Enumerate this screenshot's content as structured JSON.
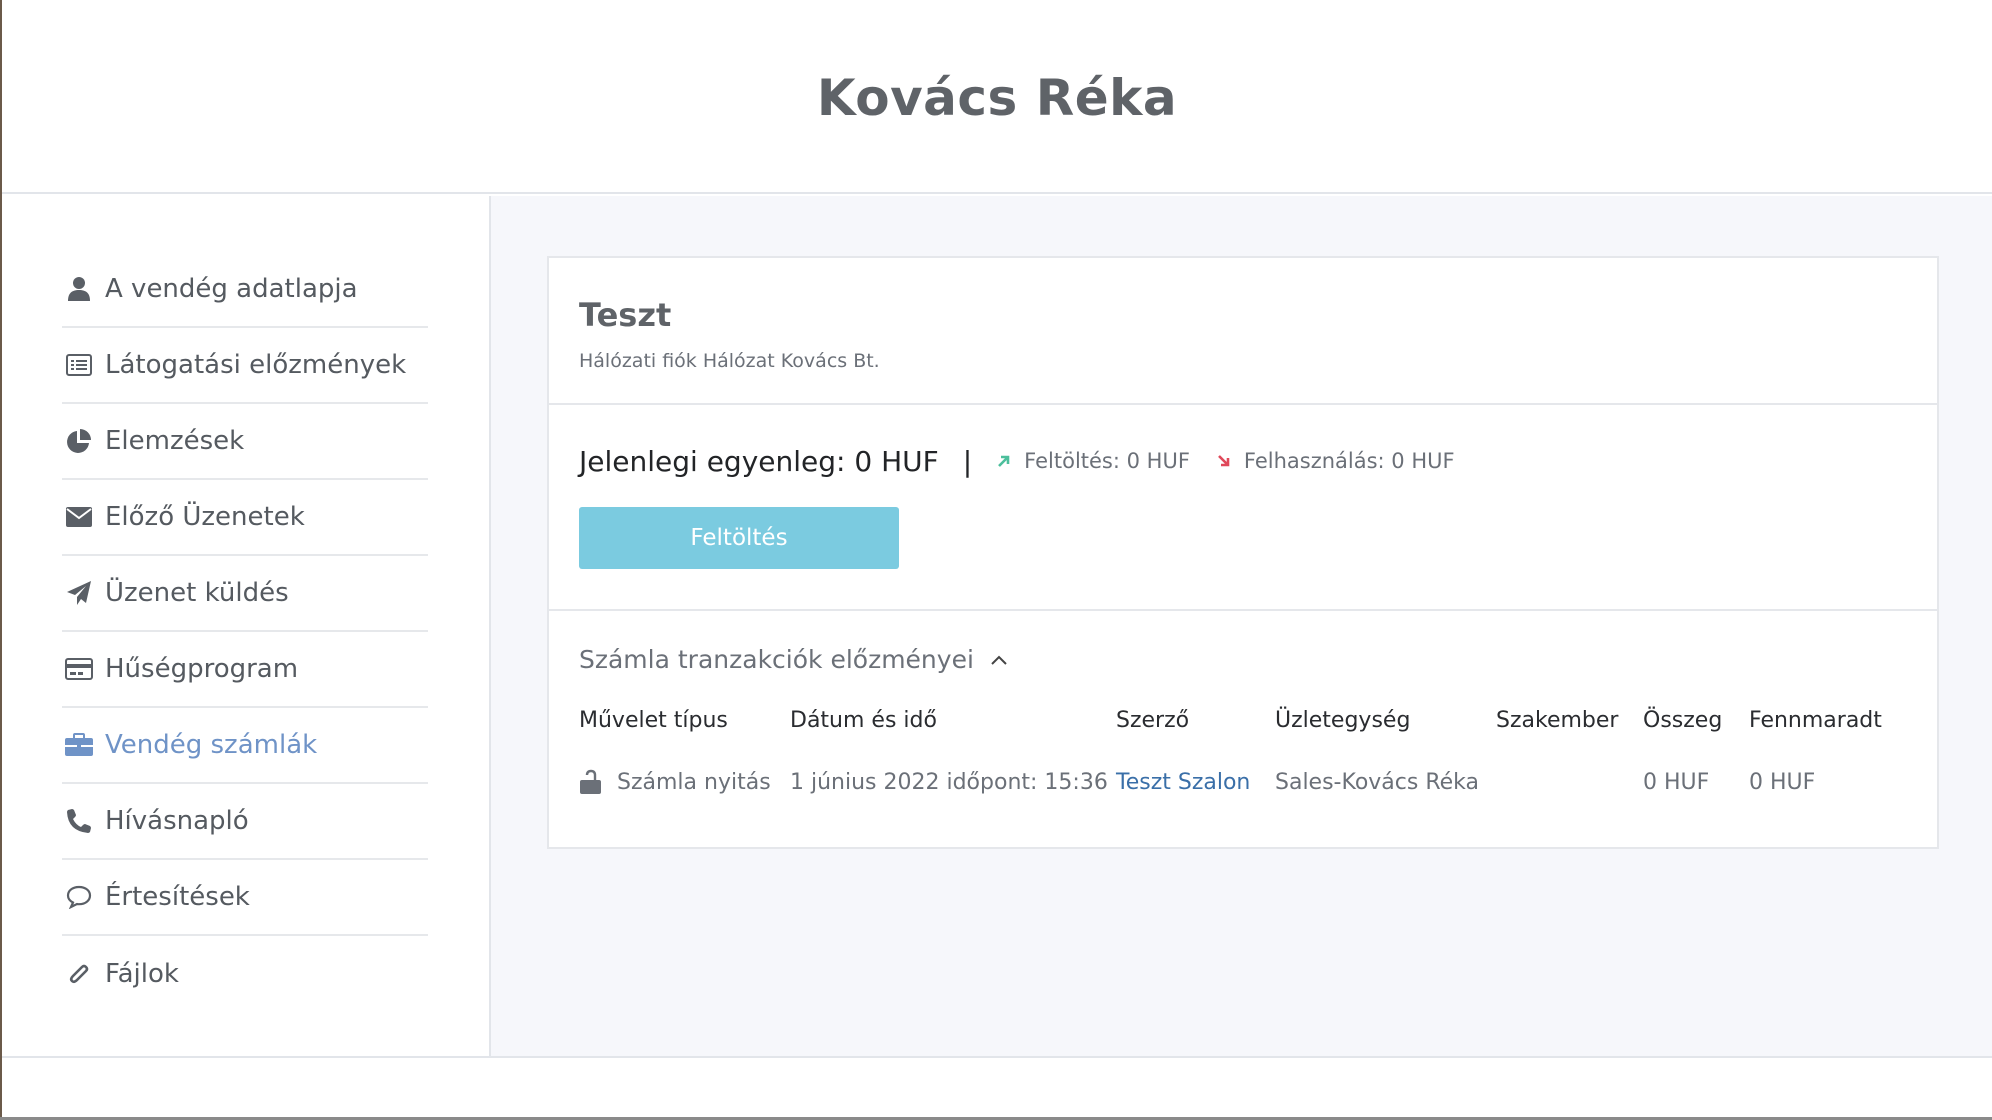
{
  "header": {
    "title": "Kovács Réka"
  },
  "sidebar": {
    "items": [
      {
        "label": "A vendég adatlapja",
        "icon": "user-icon"
      },
      {
        "label": "Látogatási előzmények",
        "icon": "list-icon"
      },
      {
        "label": "Elemzések",
        "icon": "pie-chart-icon"
      },
      {
        "label": "Előző Üzenetek",
        "icon": "envelope-icon"
      },
      {
        "label": "Üzenet küldés",
        "icon": "paper-plane-icon"
      },
      {
        "label": "Hűségprogram",
        "icon": "credit-card-icon"
      },
      {
        "label": "Vendég számlák",
        "icon": "briefcase-icon",
        "active": true
      },
      {
        "label": "Hívásnapló",
        "icon": "phone-icon"
      },
      {
        "label": "Értesítések",
        "icon": "comment-icon"
      },
      {
        "label": "Fájlok",
        "icon": "paperclip-icon"
      }
    ],
    "active_color": "#6f93c7"
  },
  "account": {
    "name": "Teszt",
    "subtitle": "Hálózati fiók Hálózat Kovács Bt.",
    "balance_label": "Jelenlegi egyenleg: 0 HUF",
    "separator": "|",
    "topup_stat": "Feltöltés: 0 HUF",
    "usage_stat": "Felhasználás: 0 HUF",
    "topup_button": "Feltöltés",
    "topup_color": "#7bcbe0",
    "up_color": "#4cbf9c",
    "down_color": "#e0485a"
  },
  "history": {
    "title": "Számla tranzakciók előzményei",
    "columns": [
      "Művelet típus",
      "Dátum és idő",
      "Szerző",
      "Üzletegység",
      "Szakember",
      "Összeg",
      "Fennmaradt"
    ],
    "rows": [
      {
        "type": "Számla nyitás",
        "datetime": "1 június 2022 időpont: 15:36",
        "author": "Teszt Szalon",
        "unit": "Sales-Kovács Réka",
        "specialist": "",
        "amount": "0 HUF",
        "remaining": "0 HUF"
      }
    ]
  }
}
